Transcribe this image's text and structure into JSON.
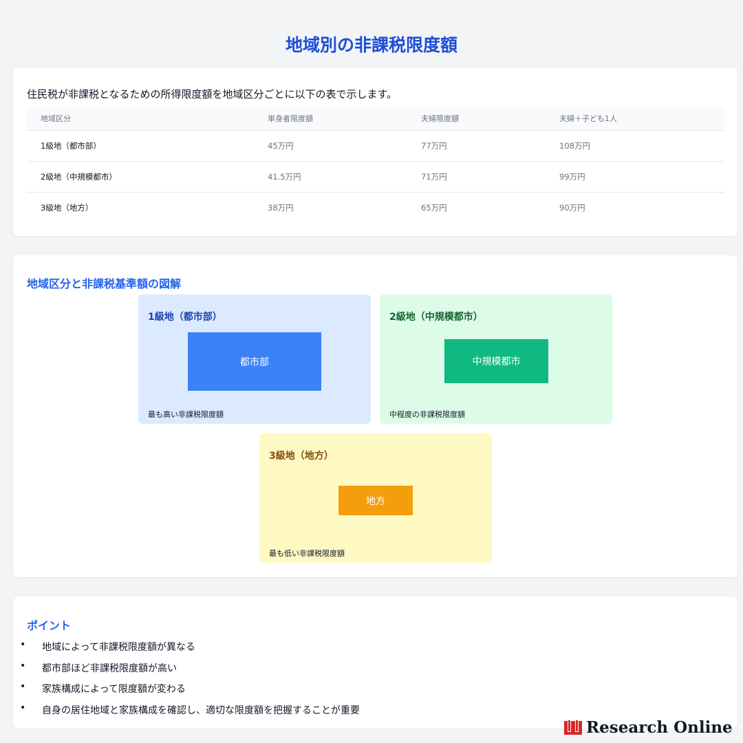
{
  "page_title": "地域別の非課税限度額",
  "table_section": {
    "intro": "住民税が非課税となるための所得限度額を地域区分ごとに以下の表で示します。",
    "columns": [
      "地域区分",
      "単身者限度額",
      "夫婦限度額",
      "夫婦＋子ども1人"
    ],
    "rows": [
      [
        "1級地（都市部）",
        "45万円",
        "77万円",
        "108万円"
      ],
      [
        "2級地（中規模都市）",
        "41.5万円",
        "71万円",
        "99万円"
      ],
      [
        "3級地（地方）",
        "38万円",
        "65万円",
        "90万円"
      ]
    ]
  },
  "diagram_section": {
    "title": "地域区分と非課税基準額の図解",
    "zones": [
      {
        "title": "1級地（都市部）",
        "box_label": "都市部",
        "description": "最も高い非課税限度額",
        "bg_color": "#dbeafe",
        "box_color": "#3b82f6"
      },
      {
        "title": "2級地（中規模都市）",
        "box_label": "中規模都市",
        "description": "中程度の非課税限度額",
        "bg_color": "#dcfce7",
        "box_color": "#10b981"
      },
      {
        "title": "3級地（地方）",
        "box_label": "地方",
        "description": "最も低い非課税限度額",
        "bg_color": "#fef9c3",
        "box_color": "#f59e0b"
      }
    ]
  },
  "points_section": {
    "title": "ポイント",
    "bullet": "•",
    "items": [
      "地域によって非課税限度額が異なる",
      "都市部ほど非課税限度額が高い",
      "家族構成によって限度額が変わる",
      "自身の居住地域と家族構成を確認し、適切な限度額を把握することが重要"
    ]
  },
  "brand": {
    "name": "Research Online",
    "icon": "research-online-logo-icon"
  },
  "colors": {
    "accent": "#1d4ed8",
    "heading": "#2563eb",
    "background": "#f3f4f6"
  }
}
